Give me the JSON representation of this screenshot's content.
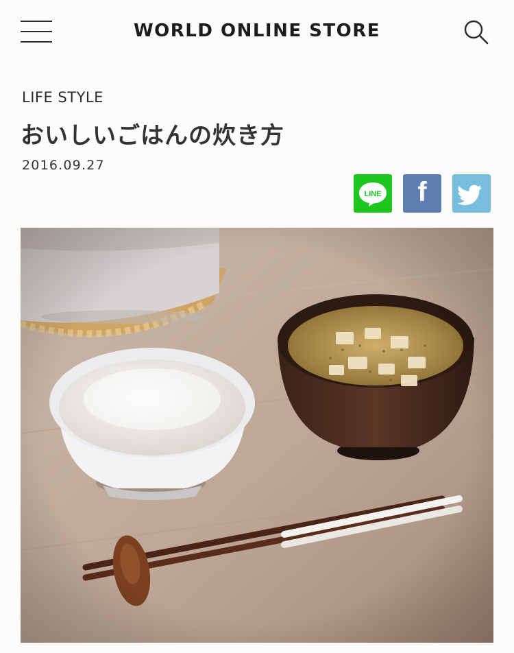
{
  "header": {
    "site_title": "WORLD ONLINE STORE",
    "menu_icon": "hamburger-menu-icon",
    "search_icon": "search-icon"
  },
  "article": {
    "category": "LIFE STYLE",
    "title": "おいしいごはんの炊き方",
    "date": "2016.09.27"
  },
  "share": {
    "line_label": "LINE",
    "facebook_icon": "facebook-icon",
    "twitter_icon": "twitter-icon",
    "colors": {
      "line": "#1dc71d",
      "facebook": "#5f7fb1",
      "twitter": "#76bedb"
    }
  },
  "hero_image": {
    "subject": "rice-bowl-miso-soup-chopsticks-photo"
  }
}
